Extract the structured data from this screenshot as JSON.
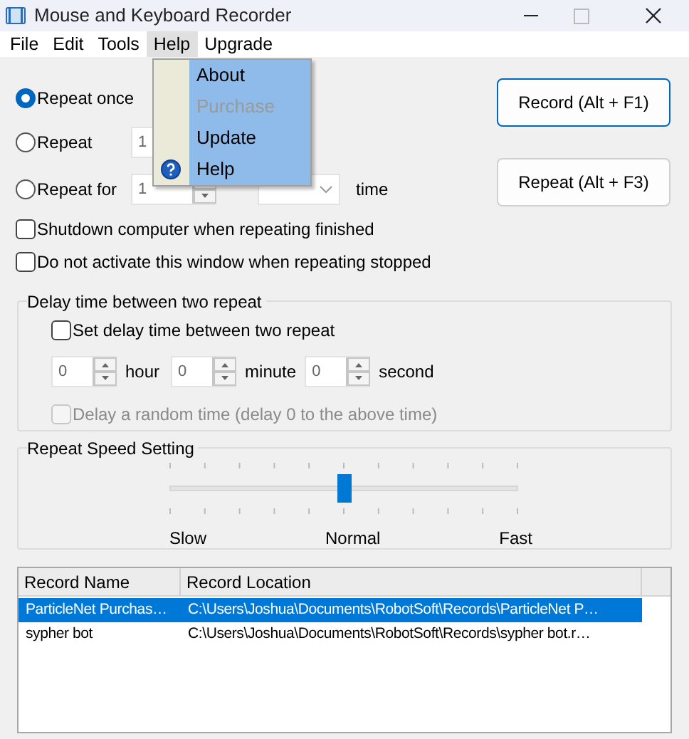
{
  "window": {
    "title": "Mouse and Keyboard Recorder"
  },
  "menu": [
    {
      "label": "File",
      "selected": false
    },
    {
      "label": "Edit",
      "selected": false
    },
    {
      "label": "Tools",
      "selected": false
    },
    {
      "label": "Help",
      "selected": true
    },
    {
      "label": "Upgrade",
      "selected": false
    }
  ],
  "help_menu": [
    {
      "label": "About",
      "disabled": false
    },
    {
      "label": "Purchase",
      "disabled": true
    },
    {
      "label": "Update",
      "disabled": false
    },
    {
      "label": "Help",
      "disabled": false,
      "kind": "icon"
    }
  ],
  "repeat_options": [
    {
      "kind": "plain",
      "label": "Repeat once",
      "selected": true
    },
    {
      "kind": "count",
      "label": "Repeat",
      "selected": false,
      "value": "1"
    },
    {
      "kind": "duration",
      "label": "Repeat for",
      "selected": false,
      "value": "1",
      "suffix": "time"
    }
  ],
  "buttons": [
    "Record (Alt + F1)",
    "Repeat (Alt + F3)"
  ],
  "options": [
    {
      "label": "Shutdown computer when repeating finished",
      "checked": false
    },
    {
      "label": "Do not activate this window when repeating stopped",
      "checked": false
    }
  ],
  "delay": {
    "title": "Delay time between two repeat",
    "set_delay": {
      "label": "Set delay time between two repeat",
      "checked": false
    },
    "fields": [
      {
        "value": "0",
        "unit": "hour"
      },
      {
        "value": "0",
        "unit": "minute"
      },
      {
        "value": "0",
        "unit": "second"
      }
    ],
    "random": {
      "label": "Delay a random time (delay 0 to the above time)",
      "checked": false,
      "disabled": true
    }
  },
  "speed": {
    "title": "Repeat Speed Setting",
    "level": 0.5,
    "labels": [
      "Slow",
      "Normal",
      "Fast"
    ]
  },
  "records": {
    "columns": [
      "Record Name",
      "Record Location"
    ],
    "rows": [
      {
        "cells": [
          "ParticleNet Purchas…",
          "C:\\Users\\Joshua\\Documents\\RobotSoft\\Records\\ParticleNet P…"
        ],
        "selected": true
      },
      {
        "cells": [
          "sypher bot",
          "C:\\Users\\Joshua\\Documents\\RobotSoft\\Records\\sypher bot.r…"
        ],
        "selected": false
      }
    ]
  }
}
